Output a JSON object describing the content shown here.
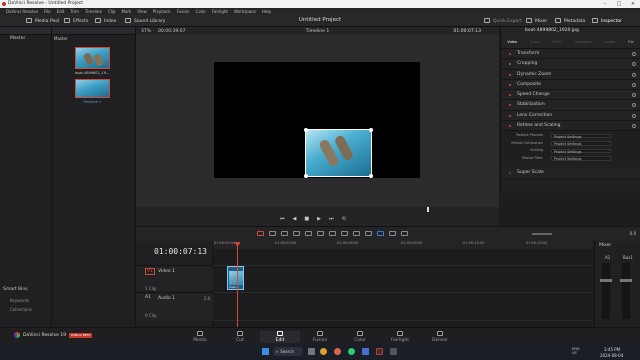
{
  "window": {
    "title": "DaVinci Resolve - Untitled Project"
  },
  "menu": [
    "DaVinci Resolve",
    "File",
    "Edit",
    "Trim",
    "Timeline",
    "Clip",
    "Mark",
    "View",
    "Playback",
    "Fusion",
    "Color",
    "Fairlight",
    "Workspace",
    "Help"
  ],
  "toolbar": {
    "media_pool": "Media Pool",
    "effects": "Effects",
    "index": "Index",
    "sound_library": "Sound Library",
    "project_title": "Untitled Project",
    "quick_export": "Quick Export",
    "mixer": "Mixer",
    "metadata": "Metadata",
    "inspector": "Inspector"
  },
  "viewer_bar": {
    "zoom": "37%",
    "source_tc": "00:00:39:07",
    "timeline_name": "Timeline 1",
    "record_tc": "01:00:07:13"
  },
  "media_pool": {
    "bins_header": "Master",
    "pool_header": "Master",
    "clips": [
      {
        "name": "boat-4899802_19..."
      },
      {
        "name": "Timeline 1"
      }
    ],
    "smart_bins": "Smart Bins",
    "smart_items": [
      "Keywords",
      "Collections"
    ]
  },
  "inspector": {
    "clip_name": "boat-4899802_1920.jpg",
    "tabs": [
      "Video",
      "Audio",
      "Effect",
      "Transition",
      "Image",
      "File"
    ],
    "rows": [
      "Transform",
      "Cropping",
      "Dynamic Zoom",
      "Composite",
      "Speed Change",
      "Stabilization",
      "Lens Correction",
      "Retime and Scaling"
    ],
    "retime": [
      {
        "label": "Retime Process",
        "value": "Project Settings"
      },
      {
        "label": "Motion Estimation",
        "value": "Project Settings"
      },
      {
        "label": "Scaling",
        "value": "Project Settings"
      },
      {
        "label": "Resize Filter",
        "value": "Project Settings"
      }
    ],
    "super_scale": "Super Scale"
  },
  "timeline": {
    "timecode": "01:00:07:13",
    "ruler": [
      "01:00:00:00",
      "01:00:03:00",
      "01:00:06:00",
      "01:00:09:00",
      "01:00:12:00",
      "01:00:15:00"
    ],
    "video_track": {
      "id": "V1",
      "name": "Video 1",
      "count": "1 Clip"
    },
    "audio_track": {
      "id": "A1",
      "name": "Audio 1",
      "level": "2.0",
      "count": "0 Clip"
    },
    "clip_label": "boat-..."
  },
  "mixer": {
    "title": "Mixer",
    "ch1": "A1",
    "ch2": "Bus1"
  },
  "pages": [
    "Media",
    "Cut",
    "Edit",
    "Fusion",
    "Color",
    "Fairlight",
    "Deliver"
  ],
  "active_page": "Edit",
  "brand": {
    "name": "DaVinci Resolve 19",
    "badge": "PUBLIC BETA"
  },
  "taskbar": {
    "search": "Search",
    "time": "3:45 PM",
    "date": "2024-08-04",
    "lang": "ENG\nUS"
  },
  "colors": {
    "accent": "#e0452f",
    "playhead": "#e0452f",
    "clip": "#3a7aa6"
  }
}
